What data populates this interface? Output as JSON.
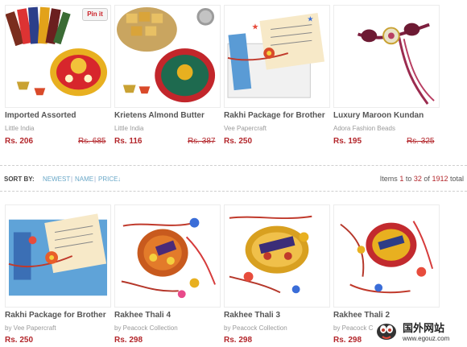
{
  "row1": [
    {
      "name": "Imported Assorted",
      "vendor": "Little India",
      "price": "Rs. 206",
      "old_price": "Rs. 685",
      "pin_label": "Pin it"
    },
    {
      "name": "Krietens Almond Butter",
      "vendor": "Little India",
      "price": "Rs. 116",
      "old_price": "Rs. 387"
    },
    {
      "name": "Rakhi Package for Brother",
      "vendor": "Vee Papercraft",
      "price": "Rs. 250"
    },
    {
      "name": "Luxury Maroon Kundan",
      "vendor": "Adora Fashion Beads",
      "price": "Rs. 195",
      "old_price": "Rs. 325"
    }
  ],
  "sort": {
    "label": "SORT BY:",
    "options": [
      "NEWEST",
      "NAME",
      "PRICE"
    ],
    "separator": "|",
    "arrow": "↓"
  },
  "items_count": {
    "prefix": "Items",
    "from": "1",
    "to_word": "to",
    "to": "32",
    "of_word": "of",
    "total": "1912",
    "suffix": "total"
  },
  "row2": [
    {
      "name": "Rakhi Package for Brother",
      "vendor": "by Vee Papercraft",
      "price": "Rs. 250"
    },
    {
      "name": "Rakhee Thali 4",
      "vendor": "by Peacock Collection",
      "price": "Rs. 298"
    },
    {
      "name": "Rakhee Thali 3",
      "vendor": "by Peacock Collection",
      "price": "Rs. 298"
    },
    {
      "name": "Rakhee Thali 2",
      "vendor": "by Peacock C",
      "price": "Rs. 298"
    }
  ],
  "watermark": {
    "text_cn": "国外网站",
    "url": "www.egouz.com"
  },
  "colors": {
    "price": "#b3262b",
    "link": "#6aa8c8",
    "text": "#555555"
  }
}
